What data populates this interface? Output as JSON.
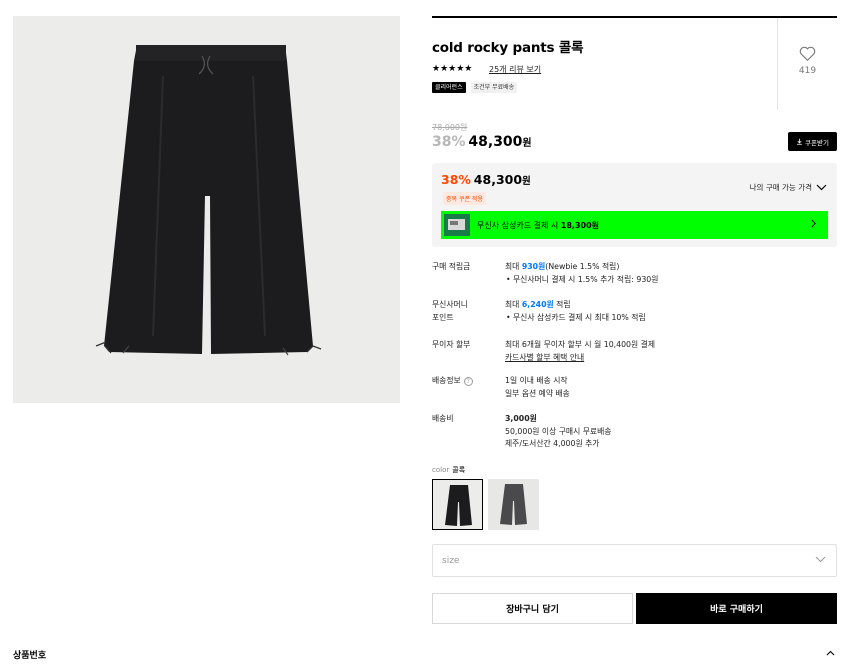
{
  "product": {
    "title": "cold rocky pants 콜록",
    "rating_stars": "★★★★★",
    "review_link": "25개 리뷰 보기",
    "badges": [
      "클리어런스",
      "조건부 무료배송"
    ],
    "like_count": "419",
    "original_price": "78,000원",
    "discount": "38%",
    "price": "48,300",
    "won": "원",
    "coupon_button": "쿠폰받기",
    "coupon_icon": "download-icon",
    "heart_icon": "heart-outline-icon"
  },
  "price_box": {
    "discount": "38%",
    "price": "48,300",
    "won": "원",
    "coupon_tag": "중복 쿠폰 적용",
    "my_price_label": "나의 구매 가능 가격",
    "card_prefix": "무신사 삼성카드 결제 시 ",
    "card_amount": "18,300원",
    "accent_green": "#00ff00",
    "discount_color": "#ff4800"
  },
  "info": {
    "points": {
      "label": "구매 적립금",
      "prefix": "최대 ",
      "amount": "930원",
      "suffix": "(Newbie 1.5% 적립)",
      "bullet": "무신사머니 결제 시 1.5% 추가 적립: 930원"
    },
    "money_points": {
      "label_line1": "무신사머니",
      "label_line2": "포인트",
      "prefix": "최대 ",
      "amount": "6,240원",
      "suffix": " 적립",
      "bullet": "무신사 삼성카드 결제 시 최대 10% 적립"
    },
    "installment": {
      "label": "무이자 할부",
      "line1": "최대 6개월 무이자 할부 시 월 10,400원 결제",
      "link": "카드사별 할부 혜택 안내"
    },
    "delivery": {
      "label": "배송정보",
      "help_icon": "?",
      "line1": "1일 이내 배송 시작",
      "line2": "일부 옵션 예약 배송"
    },
    "shipping_fee": {
      "label": "배송비",
      "amount": "3,000원",
      "line1": "50,000원 이상 구매시 무료배송",
      "line2": "제주/도서산간 4,000원 추가"
    }
  },
  "options": {
    "color_label": "color",
    "color_value": "콜록",
    "size_placeholder": "size"
  },
  "buttons": {
    "cart": "장바구니 담기",
    "buy": "바로 구매하기"
  },
  "footer": {
    "label": "상품번호"
  }
}
